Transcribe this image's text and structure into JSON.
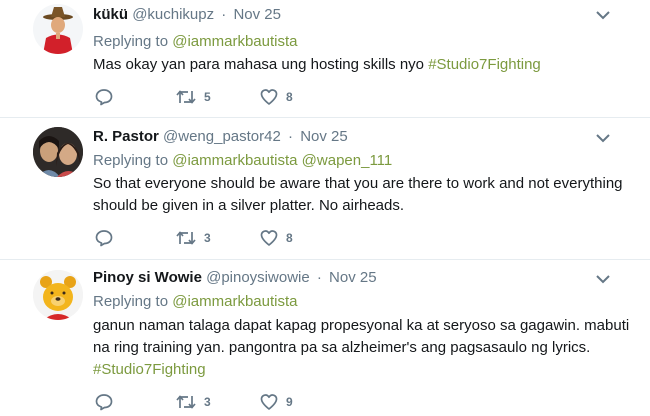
{
  "tweets": [
    {
      "name": "kükü",
      "handle": "@kuchikupz",
      "time": "Nov 25",
      "replying_label": "Replying to",
      "mentions": [
        "@iammarkbautista"
      ],
      "text": "Mas okay yan para mahasa ung hosting skills nyo ",
      "hashtag": "#Studio7Fighting",
      "retweets": "5",
      "likes": "8",
      "avatar_icon": "mountie-hat-man-avatar"
    },
    {
      "name": "R. Pastor",
      "handle": "@weng_pastor42",
      "time": "Nov 25",
      "replying_label": "Replying to",
      "mentions": [
        "@iammarkbautista",
        "@wapen_111"
      ],
      "text": "So that everyone should be aware that you are there to work and not everything should be given in a silver platter. No airheads.",
      "retweets": "3",
      "likes": "8",
      "avatar_icon": "couple-photo-avatar"
    },
    {
      "name": "Pinoy si Wowie",
      "handle": "@pinoysiwowie",
      "time": "Nov 25",
      "replying_label": "Replying to",
      "mentions": [
        "@iammarkbautista"
      ],
      "text_line1": "ganun naman talaga dapat kapag propesyonal ka at seryoso sa gagawin. mabuti",
      "text_line2": "na ring training yan. pangontra pa sa alzheimer's ang pagsasaulo ng lyrics.",
      "hashtag": "#Studio7Fighting",
      "retweets": "3",
      "likes": "9",
      "avatar_icon": "winnie-the-pooh-avatar"
    }
  ],
  "colors": {
    "accent": "#7c9a3f",
    "muted": "#657786",
    "text": "#14171a",
    "divider": "#e6ecf0"
  }
}
